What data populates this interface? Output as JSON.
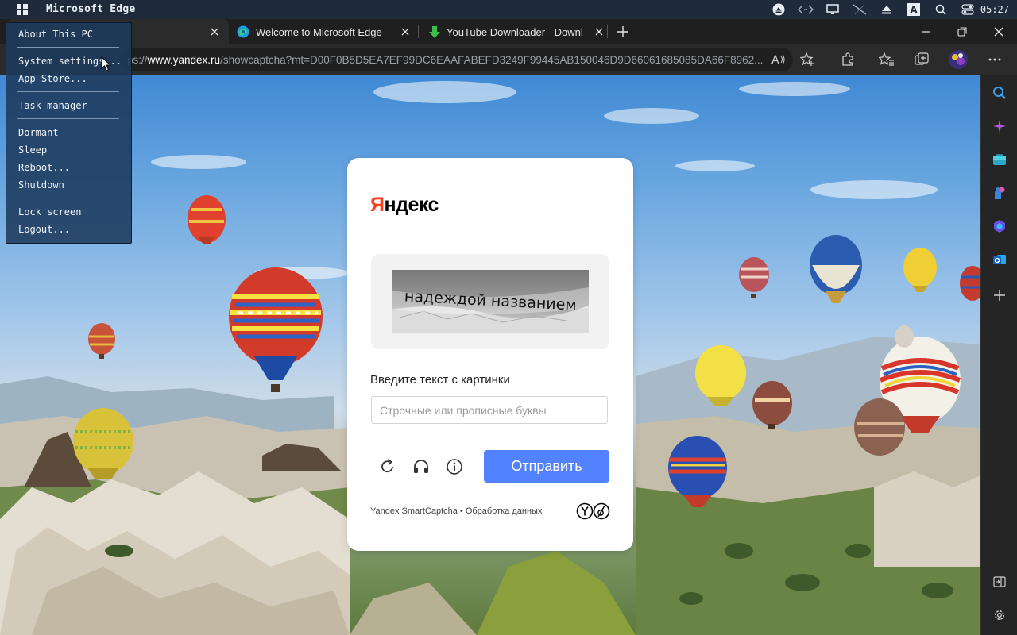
{
  "os_bar": {
    "app_title": "Microsoft Edge",
    "clock": "05:27",
    "tray_icons": [
      "eject-icon",
      "code-icon",
      "monitor-icon",
      "no-network-icon",
      "upload-icon",
      "keyboard-layout-icon",
      "search-icon",
      "toggle-icon"
    ],
    "keyboard_layout": "A"
  },
  "start_menu": {
    "items": [
      "About This PC",
      "System settings...",
      "App Store...",
      "Task manager",
      "Dormant",
      "Sleep",
      "Reboot...",
      "Shutdown",
      "Lock screen",
      "Logout..."
    ]
  },
  "tabs": [
    {
      "title": "",
      "icon": "blank",
      "active": true
    },
    {
      "title": "Welcome to Microsoft Edge",
      "icon": "edge-logo-icon",
      "active": false
    },
    {
      "title": "YouTube Downloader - Download",
      "icon": "download-arrow-icon",
      "active": false
    }
  ],
  "address_bar": {
    "url_prefix": "ps://",
    "url_host": "www.yandex.ru",
    "url_path": "/showcaptcha?mt=D00F0B5D5EA7EF99DC6EAAFABEFD3249F99445AB150046D9D66061685085DA66F8962..."
  },
  "captcha": {
    "logo_first": "Я",
    "logo_rest": "ндекс",
    "captcha_words": "надеждой названием",
    "prompt": "Введите текст с картинки",
    "input_placeholder": "Строчные или прописные буквы",
    "input_value": "",
    "submit_label": "Отправить",
    "footer_brand": "Yandex SmartCaptcha",
    "footer_separator": " • ",
    "footer_link": "Обработка данных"
  },
  "colors": {
    "os_bar": "#1f2a3a",
    "browser_dark": "#2b2b2b",
    "yandex_red": "#fc3f1d",
    "submit_blue": "#5282ff",
    "menu_bg": "#1e3a5c"
  }
}
